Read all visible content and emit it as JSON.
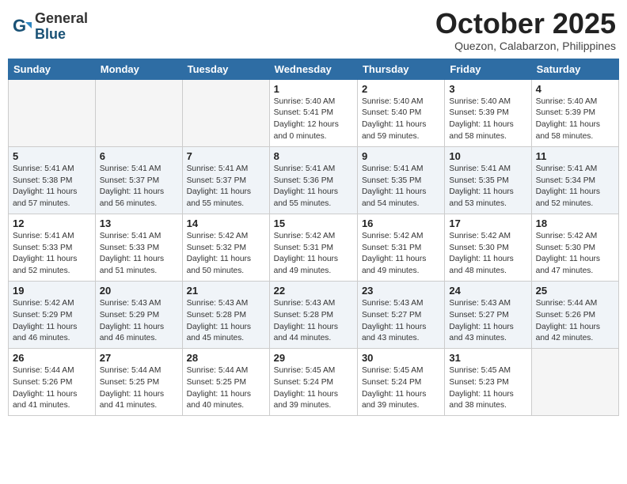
{
  "logo": {
    "general": "General",
    "blue": "Blue"
  },
  "header": {
    "month": "October 2025",
    "location": "Quezon, Calabarzon, Philippines"
  },
  "weekdays": [
    "Sunday",
    "Monday",
    "Tuesday",
    "Wednesday",
    "Thursday",
    "Friday",
    "Saturday"
  ],
  "weeks": [
    [
      {
        "day": "",
        "info": ""
      },
      {
        "day": "",
        "info": ""
      },
      {
        "day": "",
        "info": ""
      },
      {
        "day": "1",
        "info": "Sunrise: 5:40 AM\nSunset: 5:41 PM\nDaylight: 12 hours\nand 0 minutes."
      },
      {
        "day": "2",
        "info": "Sunrise: 5:40 AM\nSunset: 5:40 PM\nDaylight: 11 hours\nand 59 minutes."
      },
      {
        "day": "3",
        "info": "Sunrise: 5:40 AM\nSunset: 5:39 PM\nDaylight: 11 hours\nand 58 minutes."
      },
      {
        "day": "4",
        "info": "Sunrise: 5:40 AM\nSunset: 5:39 PM\nDaylight: 11 hours\nand 58 minutes."
      }
    ],
    [
      {
        "day": "5",
        "info": "Sunrise: 5:41 AM\nSunset: 5:38 PM\nDaylight: 11 hours\nand 57 minutes."
      },
      {
        "day": "6",
        "info": "Sunrise: 5:41 AM\nSunset: 5:37 PM\nDaylight: 11 hours\nand 56 minutes."
      },
      {
        "day": "7",
        "info": "Sunrise: 5:41 AM\nSunset: 5:37 PM\nDaylight: 11 hours\nand 55 minutes."
      },
      {
        "day": "8",
        "info": "Sunrise: 5:41 AM\nSunset: 5:36 PM\nDaylight: 11 hours\nand 55 minutes."
      },
      {
        "day": "9",
        "info": "Sunrise: 5:41 AM\nSunset: 5:35 PM\nDaylight: 11 hours\nand 54 minutes."
      },
      {
        "day": "10",
        "info": "Sunrise: 5:41 AM\nSunset: 5:35 PM\nDaylight: 11 hours\nand 53 minutes."
      },
      {
        "day": "11",
        "info": "Sunrise: 5:41 AM\nSunset: 5:34 PM\nDaylight: 11 hours\nand 52 minutes."
      }
    ],
    [
      {
        "day": "12",
        "info": "Sunrise: 5:41 AM\nSunset: 5:33 PM\nDaylight: 11 hours\nand 52 minutes."
      },
      {
        "day": "13",
        "info": "Sunrise: 5:41 AM\nSunset: 5:33 PM\nDaylight: 11 hours\nand 51 minutes."
      },
      {
        "day": "14",
        "info": "Sunrise: 5:42 AM\nSunset: 5:32 PM\nDaylight: 11 hours\nand 50 minutes."
      },
      {
        "day": "15",
        "info": "Sunrise: 5:42 AM\nSunset: 5:31 PM\nDaylight: 11 hours\nand 49 minutes."
      },
      {
        "day": "16",
        "info": "Sunrise: 5:42 AM\nSunset: 5:31 PM\nDaylight: 11 hours\nand 49 minutes."
      },
      {
        "day": "17",
        "info": "Sunrise: 5:42 AM\nSunset: 5:30 PM\nDaylight: 11 hours\nand 48 minutes."
      },
      {
        "day": "18",
        "info": "Sunrise: 5:42 AM\nSunset: 5:30 PM\nDaylight: 11 hours\nand 47 minutes."
      }
    ],
    [
      {
        "day": "19",
        "info": "Sunrise: 5:42 AM\nSunset: 5:29 PM\nDaylight: 11 hours\nand 46 minutes."
      },
      {
        "day": "20",
        "info": "Sunrise: 5:43 AM\nSunset: 5:29 PM\nDaylight: 11 hours\nand 46 minutes."
      },
      {
        "day": "21",
        "info": "Sunrise: 5:43 AM\nSunset: 5:28 PM\nDaylight: 11 hours\nand 45 minutes."
      },
      {
        "day": "22",
        "info": "Sunrise: 5:43 AM\nSunset: 5:28 PM\nDaylight: 11 hours\nand 44 minutes."
      },
      {
        "day": "23",
        "info": "Sunrise: 5:43 AM\nSunset: 5:27 PM\nDaylight: 11 hours\nand 43 minutes."
      },
      {
        "day": "24",
        "info": "Sunrise: 5:43 AM\nSunset: 5:27 PM\nDaylight: 11 hours\nand 43 minutes."
      },
      {
        "day": "25",
        "info": "Sunrise: 5:44 AM\nSunset: 5:26 PM\nDaylight: 11 hours\nand 42 minutes."
      }
    ],
    [
      {
        "day": "26",
        "info": "Sunrise: 5:44 AM\nSunset: 5:26 PM\nDaylight: 11 hours\nand 41 minutes."
      },
      {
        "day": "27",
        "info": "Sunrise: 5:44 AM\nSunset: 5:25 PM\nDaylight: 11 hours\nand 41 minutes."
      },
      {
        "day": "28",
        "info": "Sunrise: 5:44 AM\nSunset: 5:25 PM\nDaylight: 11 hours\nand 40 minutes."
      },
      {
        "day": "29",
        "info": "Sunrise: 5:45 AM\nSunset: 5:24 PM\nDaylight: 11 hours\nand 39 minutes."
      },
      {
        "day": "30",
        "info": "Sunrise: 5:45 AM\nSunset: 5:24 PM\nDaylight: 11 hours\nand 39 minutes."
      },
      {
        "day": "31",
        "info": "Sunrise: 5:45 AM\nSunset: 5:23 PM\nDaylight: 11 hours\nand 38 minutes."
      },
      {
        "day": "",
        "info": ""
      }
    ]
  ]
}
